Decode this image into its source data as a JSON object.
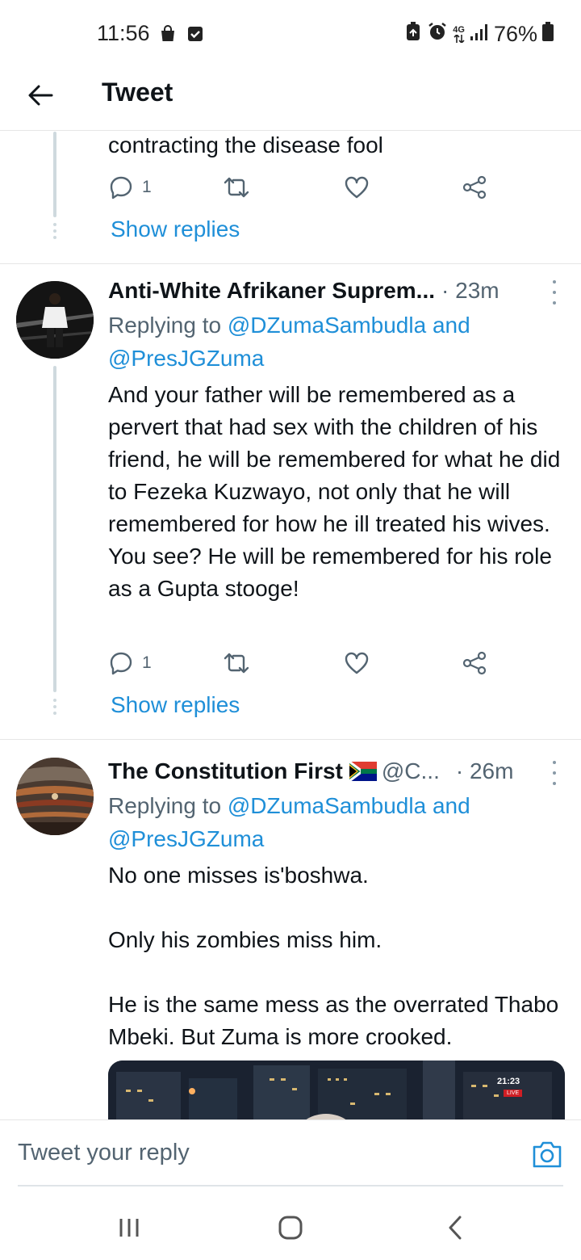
{
  "status_bar": {
    "time": "11:56",
    "network": "4G",
    "battery": "76%",
    "left_icons": [
      "shopping-bag-icon",
      "checkbox-icon"
    ],
    "right_icons": [
      "battery-saver-icon",
      "alarm-icon",
      "network-4g-icon",
      "signal-icon",
      "battery-icon"
    ]
  },
  "header": {
    "title": "Tweet",
    "back_icon": "arrow-left-icon"
  },
  "colors": {
    "link": "#1f8fd8",
    "muted": "#536471",
    "text": "#0f1419",
    "divider": "#e6e6e6",
    "thread_line": "#cfd9de"
  },
  "tweets": [
    {
      "text": "contracting the disease fool",
      "reply_count": "1",
      "show_replies": "Show replies"
    },
    {
      "name": "Anti-White Afrikaner Suprem...",
      "handle": "",
      "time": "· 23m",
      "replying_label": "Replying to",
      "replying_mention1": "@DZumaSambudla",
      "replying_and": "and",
      "replying_mention2": "@PresJGZuma",
      "text": "And your father will be remembered as a pervert that had sex with the children of his friend, he will be remembered for what he did to Fezeka Kuzwayo, not only that he will remembered for how he ill treated his wives. You see? He will be remembered for his role as a Gupta stooge!",
      "reply_count": "1",
      "show_replies": "Show replies"
    },
    {
      "name": "The Constitution First",
      "flag": "🇿🇦",
      "handle": "@C...",
      "time": "· 26m",
      "replying_label": "Replying to",
      "replying_mention1": "@DZumaSambudla",
      "replying_and": "and",
      "replying_mention2": "@PresJGZuma",
      "text_lines": [
        "No one misses is'boshwa.",
        "Only his zombies miss him.",
        "He is the same mess as the overrated Thabo Mbeki. But Zuma is more crooked."
      ],
      "media": {
        "clock": "21:23",
        "live": "LIVE"
      }
    }
  ],
  "reply_bar": {
    "placeholder": "Tweet your reply",
    "camera_icon": "camera-icon"
  },
  "nav_bar": {
    "icons": [
      "recent-apps-icon",
      "home-icon",
      "back-icon"
    ]
  }
}
